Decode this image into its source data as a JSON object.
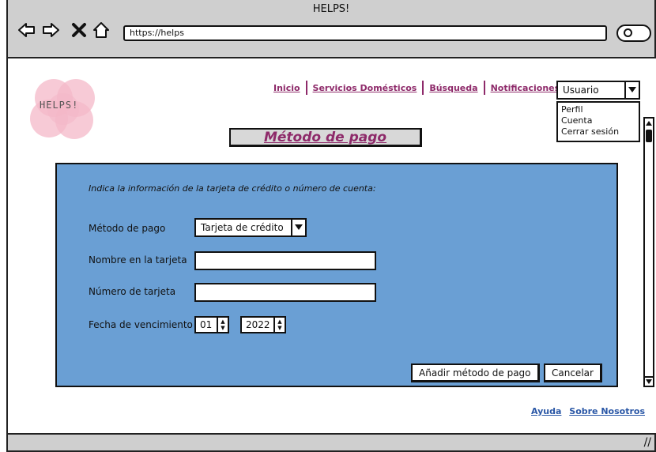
{
  "window": {
    "title": "HELPS!"
  },
  "browser": {
    "url": "https://helps"
  },
  "logo": {
    "text": "HELPS!"
  },
  "nav": {
    "items": [
      "Inicio",
      "Servicios Domésticos",
      "Búsqueda",
      "Notificaciones"
    ]
  },
  "user_menu": {
    "selected": "Usuario",
    "options": [
      "Perfil",
      "Cuenta",
      "Cerrar sesión"
    ]
  },
  "page": {
    "title": "Método de pago"
  },
  "form": {
    "instructions": "Indica la información de la tarjeta de crédito o número de cuenta:",
    "payment_method_label": "Método de pago",
    "payment_method_value": "Tarjeta de crédito",
    "card_name_label": "Nombre en la tarjeta",
    "card_number_label": "Número de tarjeta",
    "expiry_label": "Fecha de vencimiento",
    "expiry_month": "01",
    "expiry_year": "2022",
    "add_button": "Añadir método de pago",
    "cancel_button": "Cancelar"
  },
  "footer": {
    "help": "Ayuda",
    "about": "Sobre Nosotros"
  },
  "colors": {
    "panel": "#6a9fd4",
    "accent": "#8e2a6a",
    "link": "#2a57a6",
    "logo_pink": "#f4b8c8"
  }
}
